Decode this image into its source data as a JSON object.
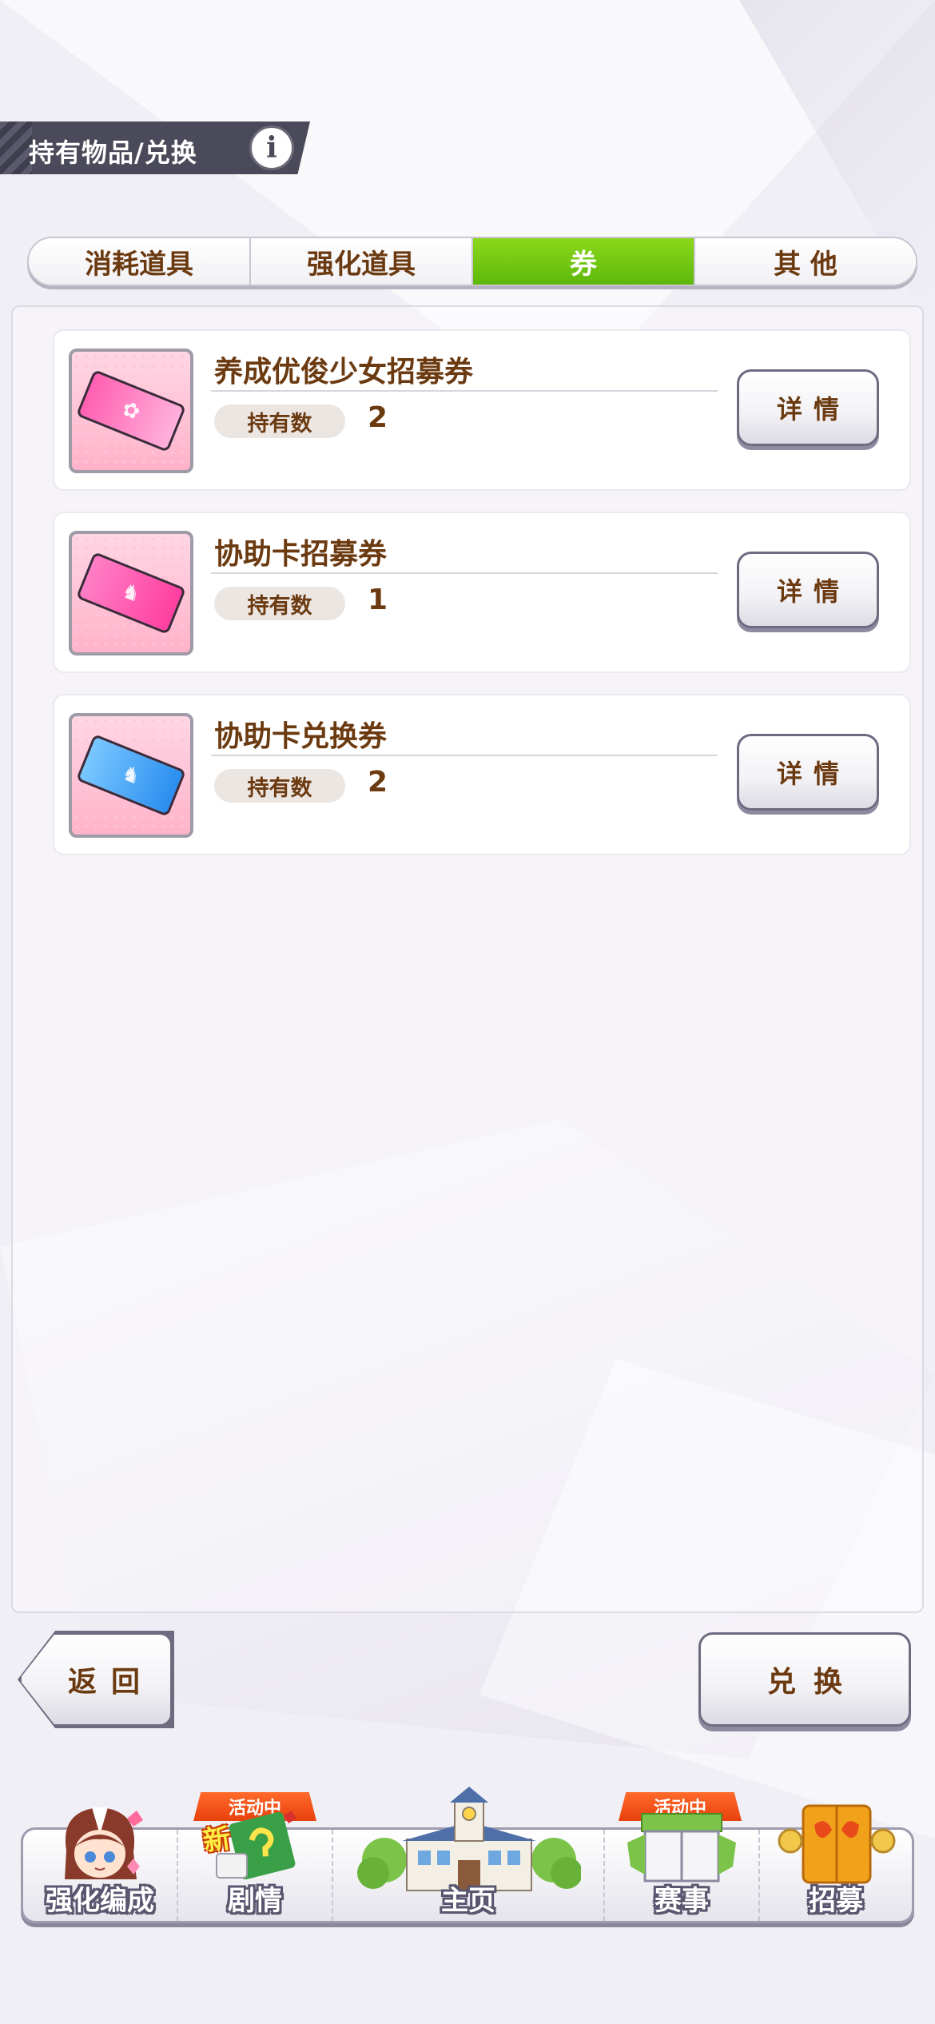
{
  "header": {
    "title": "持有物品/兑换",
    "info_label": "i"
  },
  "tabs": [
    {
      "label": "消耗道具",
      "active": false
    },
    {
      "label": "强化道具",
      "active": false
    },
    {
      "label": "券",
      "active": true
    },
    {
      "label": "其 他",
      "active": false
    }
  ],
  "items": [
    {
      "name": "养成优俊少女招募券",
      "count_label": "持有数",
      "count": "2",
      "detail_label": "详情",
      "icon": "pink-ticket-icon"
    },
    {
      "name": "协助卡招募券",
      "count_label": "持有数",
      "count": "1",
      "detail_label": "详情",
      "icon": "magenta-ticket-icon"
    },
    {
      "name": "协助卡兑换券",
      "count_label": "持有数",
      "count": "2",
      "detail_label": "详情",
      "icon": "blue-ticket-icon"
    }
  ],
  "actions": {
    "back_label": "返回",
    "exchange_label": "兑换"
  },
  "nav": {
    "items": [
      {
        "label": "强化编成",
        "icon": "character-icon"
      },
      {
        "label": "剧情",
        "icon": "story-book-icon",
        "badge": "活动中",
        "new_label": "新"
      },
      {
        "label": "主页",
        "icon": "school-building-icon"
      },
      {
        "label": "赛事",
        "icon": "race-gate-icon",
        "badge": "活动中"
      },
      {
        "label": "招募",
        "icon": "gacha-door-icon"
      }
    ]
  },
  "colors": {
    "accent_green": "#6cc414",
    "text_brown": "#6b3a10",
    "badge_orange": "#f0531a"
  }
}
